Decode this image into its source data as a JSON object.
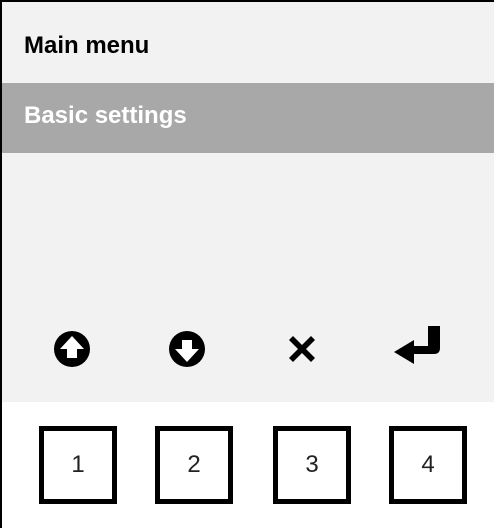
{
  "screen": {
    "title": "Main menu",
    "menu_items": [
      {
        "label": "Basic settings",
        "selected": true
      }
    ],
    "colors": {
      "background": "#f2f2f2",
      "selection": "#a8a8a8",
      "selection_text": "#ffffff"
    }
  },
  "softkey_icons": [
    {
      "name": "up-arrow-icon"
    },
    {
      "name": "down-arrow-icon"
    },
    {
      "name": "close-icon"
    },
    {
      "name": "enter-icon"
    }
  ],
  "keys": [
    {
      "label": "1"
    },
    {
      "label": "2"
    },
    {
      "label": "3"
    },
    {
      "label": "4"
    }
  ]
}
